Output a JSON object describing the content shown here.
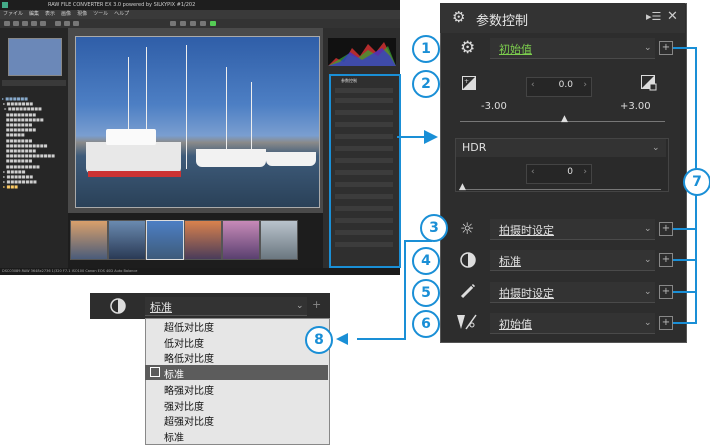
{
  "app": {
    "title": "RAW FILE CONVERTER EX 3.0 powered by SILKYPIX  #1/202",
    "menu": [
      "ファイル",
      "編集",
      "表示",
      "画像",
      "現像",
      "ツール",
      "ヘルプ"
    ],
    "status": "DSC03089.RAW  3648x2736  1/320  F7.1  ISO100  Canon EOS 40D  Auto Balance"
  },
  "panel": {
    "title": "参数控制",
    "header_icons": [
      "pin-list-icon",
      "close-icon"
    ],
    "rows": [
      {
        "num": "1",
        "icon": "gear-icon",
        "value": "初始值",
        "green": true
      },
      {
        "num": "2",
        "icon": "exposure-icon"
      },
      {
        "num": "3",
        "icon": "sun-icon",
        "value": "拍摄时设定"
      },
      {
        "num": "4",
        "icon": "contrast-icon",
        "value": "标准"
      },
      {
        "num": "5",
        "icon": "sharpness-icon",
        "value": "拍摄时设定"
      },
      {
        "num": "6",
        "icon": "lens-icon",
        "value": "初始值"
      }
    ],
    "exposure": {
      "value": "0.0",
      "min": "-3.00",
      "max": "+3.00"
    },
    "hdr": {
      "label": "HDR",
      "value": "0"
    },
    "callout7": "7"
  },
  "dropdown": {
    "current": "标准",
    "callout8": "8",
    "options": [
      "超低对比度",
      "低对比度",
      "略低对比度",
      "标准",
      "略强对比度",
      "强对比度",
      "超强对比度",
      "标准"
    ],
    "selected_index": 3
  },
  "colors": {
    "accent": "#1a8fd6",
    "green_text": "#7dcf4e",
    "panel_bg": "#2d2d2d"
  }
}
